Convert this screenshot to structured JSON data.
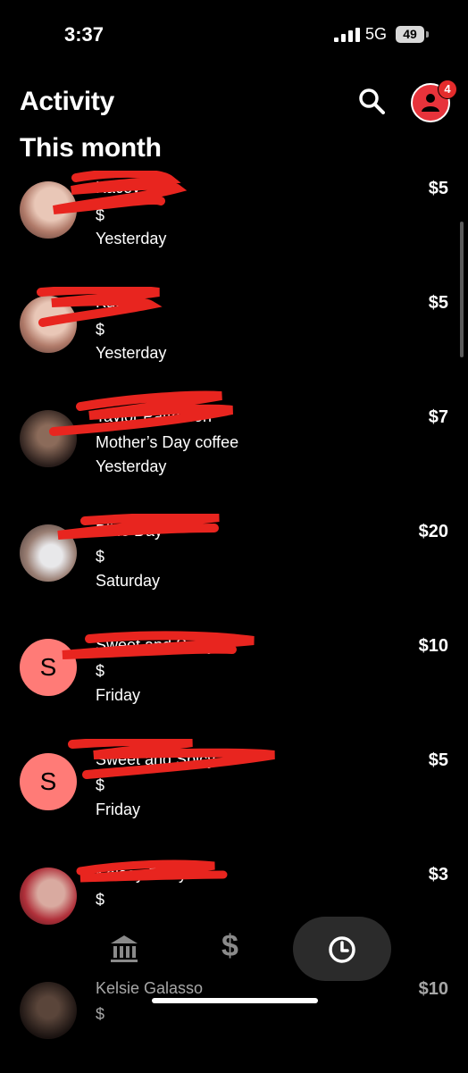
{
  "status_bar": {
    "time": "3:37",
    "network": "5G",
    "battery": "49"
  },
  "header": {
    "title": "Activity",
    "notification_count": "4"
  },
  "section_title": "This month",
  "transactions": [
    {
      "name": "Kacey",
      "note": "$",
      "when": "Yesterday",
      "amount": "$5"
    },
    {
      "name": "Kacey",
      "note": "$",
      "when": "Yesterday",
      "amount": "$5"
    },
    {
      "name": "Taylor Patterson",
      "note": "Mother’s Day coffee",
      "when": "Yesterday",
      "amount": "$7"
    },
    {
      "name": "Billie Day",
      "note": "$",
      "when": "Saturday",
      "amount": "$20"
    },
    {
      "name": "Sweet and Spicy",
      "note": "$",
      "when": "Friday",
      "amount": "$10",
      "avatar_letter": "S"
    },
    {
      "name": "Sweet and Spicy",
      "note": "$",
      "when": "Friday",
      "amount": "$5",
      "avatar_letter": "S"
    },
    {
      "name": "Kelsey Perry",
      "note": "$",
      "when": "",
      "amount": "$3"
    },
    {
      "name": "Kelsie Galasso",
      "note": "$",
      "when": "",
      "amount": "$10"
    }
  ],
  "bottom_nav": [
    {
      "icon": "bank-icon"
    },
    {
      "icon": "dollar-icon",
      "label": "$"
    },
    {
      "icon": "clock-icon",
      "active": true
    }
  ],
  "colors": {
    "background": "#000000",
    "accent": "#e7333b",
    "avatar_letter_bg": "#ff7b77",
    "redaction": "#e8251f"
  }
}
